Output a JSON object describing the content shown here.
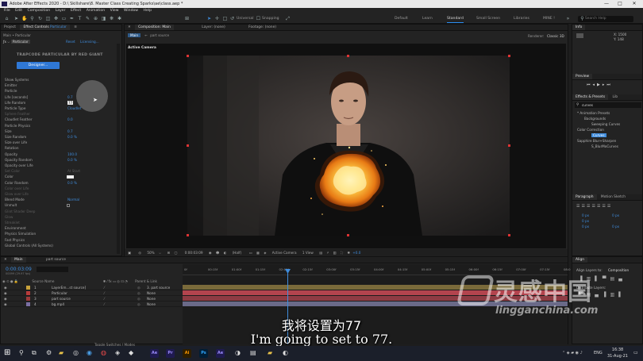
{
  "window": {
    "title": "Adobe After Effects 2020 - D:\\ Skillshare\\8. Master Class Creating Sparks\\ae\\class.aep *",
    "controls": [
      "—",
      "□",
      "✕"
    ]
  },
  "menu": [
    "File",
    "Edit",
    "Composition",
    "Layer",
    "Effect",
    "Animation",
    "View",
    "Window",
    "Help"
  ],
  "toolbar": {
    "snapping_label": "Snapping",
    "universal_label": "Universal",
    "workspaces": [
      "Default",
      "Learn",
      "Standard",
      "Small Screen",
      "Libraries",
      "MINE !"
    ],
    "active_workspace": "Standard",
    "search_placeholder": "Search Help"
  },
  "project_panel": {
    "tabs": [
      "Project",
      "Effect Controls",
      "Particular"
    ],
    "breadcrumb": "Main • Particular",
    "fx_name": "Particular",
    "reset_label": "Reset",
    "licensing_label": "Licensing...",
    "brand": "TRAPCODE PARTICULAR BY RED GIANT",
    "designer_button": "Designer...",
    "rows": [
      {
        "label": "Show Systems",
        "value": "",
        "state": "normal"
      },
      {
        "label": "Emitter",
        "value": "",
        "state": "normal"
      },
      {
        "label": "Particle",
        "value": "",
        "state": "normal"
      },
      {
        "label": "Life [seconds]",
        "value": "0.7",
        "state": "normal"
      },
      {
        "label": "Life Random",
        "value": "77",
        "state": "edit"
      },
      {
        "label": "Particle Type",
        "value": "Cloudlet",
        "state": "normal"
      },
      {
        "label": "Sphere Feather",
        "value": "",
        "state": "dim"
      },
      {
        "label": "Cloudlet Feather",
        "value": "0.0",
        "state": "normal"
      },
      {
        "label": "Particle Physics",
        "value": "",
        "state": "normal"
      },
      {
        "label": "Size",
        "value": "0.7",
        "state": "normal"
      },
      {
        "label": "Size Random",
        "value": "0.0 %",
        "state": "normal"
      },
      {
        "label": "Size over Life",
        "value": "",
        "state": "normal"
      },
      {
        "label": "Rotation",
        "value": "",
        "state": "normal"
      },
      {
        "label": "Opacity",
        "value": "100.0",
        "state": "normal"
      },
      {
        "label": "Opacity Random",
        "value": "0.0 %",
        "state": "normal"
      },
      {
        "label": "Opacity over Life",
        "value": "",
        "state": "normal"
      },
      {
        "label": "Set Color",
        "value": "At Start",
        "state": "dim"
      },
      {
        "label": "Color",
        "value": "",
        "state": "swatch"
      },
      {
        "label": "Color Random",
        "value": "0.0 %",
        "state": "normal"
      },
      {
        "label": "Color over Life",
        "value": "",
        "state": "dim"
      },
      {
        "label": "Glow over Life",
        "value": "",
        "state": "dim"
      },
      {
        "label": "Blend Mode",
        "value": "Normal",
        "state": "normal"
      },
      {
        "label": "Unmult",
        "value": "",
        "state": "checkbox"
      },
      {
        "label": "Glint Shader Deep",
        "value": "",
        "state": "dim"
      },
      {
        "label": "Glow",
        "value": "",
        "state": "dim"
      },
      {
        "label": "Streaklet",
        "value": "",
        "state": "dim"
      },
      {
        "label": "Environment",
        "value": "",
        "state": "normal"
      },
      {
        "label": "Physics Simulation",
        "value": "",
        "state": "normal"
      },
      {
        "label": "Fast Physics",
        "value": "",
        "state": "normal"
      },
      {
        "label": "Global Controls (All Systems)",
        "value": "",
        "state": "normal"
      }
    ]
  },
  "composition": {
    "tabs": [
      "Composition: Main",
      "Layer: (none)",
      "Footage: (none)"
    ],
    "comp_name": "Main",
    "subtab": "part source",
    "renderer_label": "Renderer:",
    "renderer_value": "Classic 3D",
    "active_camera_label": "Active Camera",
    "bottom_bar": {
      "zoom": "50%",
      "timecode": "0:00:03:09",
      "resolution": "(Half)",
      "camera": "Active Camera",
      "view": "1 View",
      "exposure": "+0.0"
    }
  },
  "right_panel": {
    "info_tab": "Info",
    "info_values": [
      "X: 1500",
      "Y: 148"
    ],
    "preview_tab": "Preview",
    "effects_tab": "Effects & Presets",
    "libraries_tab": "Lib",
    "search_value": "curves",
    "tree": [
      {
        "label": "* Animation Presets",
        "indent": 0
      },
      {
        "label": "Backgrounds",
        "indent": 1
      },
      {
        "label": "Sweeping Curves",
        "indent": 2
      },
      {
        "label": "Color Correction",
        "indent": 0
      },
      {
        "label": "Curves",
        "indent": 2,
        "selected": true
      },
      {
        "label": "Sapphire Blur+Sharpen",
        "indent": 0
      },
      {
        "label": "S_BlurMoCurves",
        "indent": 2
      }
    ],
    "paragraph_tab": "Paragraph",
    "motion_sketch_tab": "Motion Sketch",
    "para_values": [
      "0 px",
      "0 px",
      "0 px",
      "0 px",
      "0 px"
    ]
  },
  "timeline": {
    "tabs": [
      "Main",
      "part source"
    ],
    "timecode": "0:00:03:09",
    "subframe": "00099 (29.97 fps)",
    "columns": {
      "source_name": "Source Name",
      "parent": "Parent & Link"
    },
    "layers": [
      {
        "num": "1",
        "name": "LayerEm...st source]",
        "parent": "3. part source",
        "color": "#c8a23b"
      },
      {
        "num": "2",
        "name": "Particular",
        "parent": "None",
        "color": "#b83a3a"
      },
      {
        "num": "3",
        "name": "part source",
        "parent": "None",
        "color": "#9d3a3a"
      },
      {
        "num": "4",
        "name": "bg.mp4",
        "parent": "None",
        "color": "#7b6fa3"
      }
    ],
    "ruler": [
      "0f",
      "00:15f",
      "01:00f",
      "01:15f",
      "02:00f",
      "02:15f",
      "03:00f",
      "03:15f",
      "04:00f",
      "04:15f",
      "05:00f",
      "05:15f",
      "06:00f",
      "06:15f",
      "07:00f",
      "07:15f",
      "08:0"
    ],
    "toggle_label": "Toggle Switches / Modes"
  },
  "align_panel": {
    "title": "Align",
    "align_to_label": "Align Layers to:",
    "align_to_value": "Composition",
    "distribute_label": "Distribute Layers:"
  },
  "taskbar": {
    "apps": [
      "Ae",
      "Pr",
      "Ai",
      "Ps",
      "Ae"
    ],
    "tray_lang": "ENG",
    "time": "16:38",
    "date": "31-Aug-21"
  },
  "subtitle": {
    "cn": "我将设置为77",
    "en": "I'm going to set to 77."
  },
  "watermark": {
    "cn": "灵感中国",
    "url": "lingganchina.com"
  },
  "colors": {
    "accent": "#3f8cdc",
    "panel": "#232323",
    "timeline_red_bar": "#b3444e"
  }
}
